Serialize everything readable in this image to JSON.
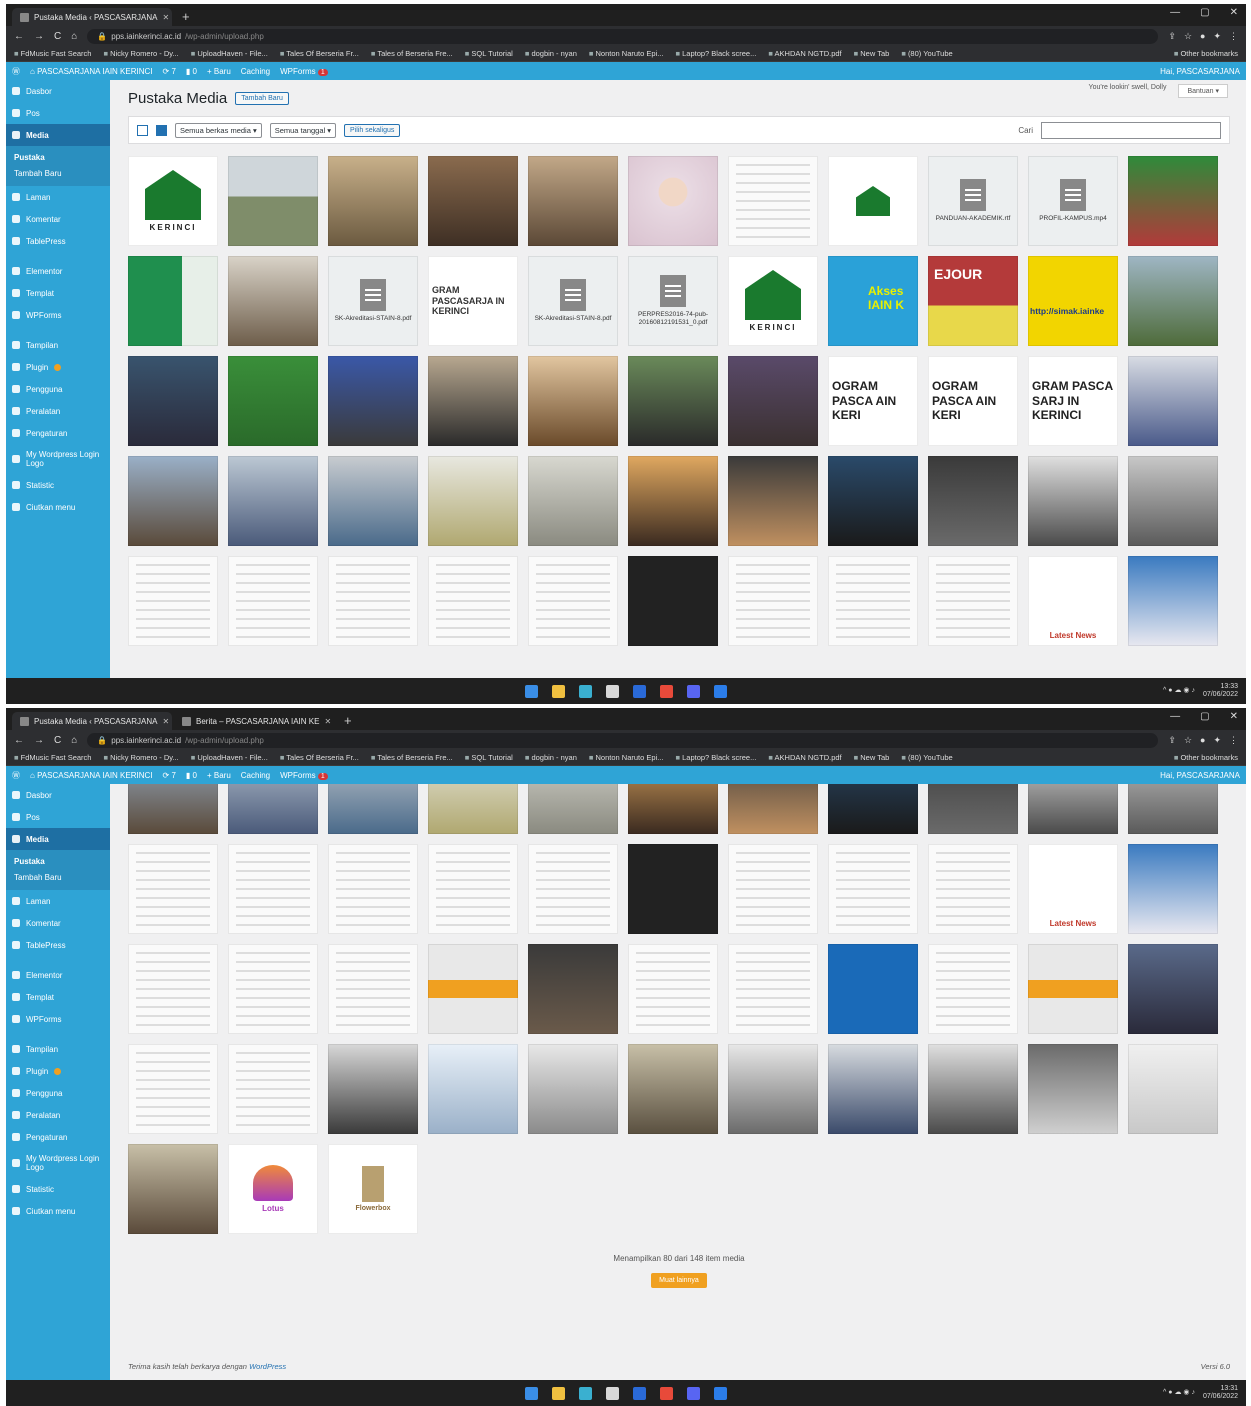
{
  "browser": {
    "tabs_top": [
      "Pustaka Media ‹ PASCASARJANA"
    ],
    "tabs_bottom": [
      "Pustaka Media ‹ PASCASARJANA",
      "Berita – PASCASARJANA IAIN KE"
    ],
    "url_host": "pps.iainkerinci.ac.id",
    "url_path": "/wp-admin/upload.php",
    "bookmarks": [
      "FdMusic Fast Search",
      "Nicky Romero - Dy...",
      "UploadHaven - File...",
      "Tales Of Berseria Fr...",
      "Tales of Berseria Fre...",
      "SQL Tutorial",
      "dogbin - nyan",
      "Nonton Naruto Epi...",
      "Laptop? Black scree...",
      "AKHDAN NGTD.pdf",
      "New Tab",
      "(80) YouTube"
    ],
    "other_bookmarks": "Other bookmarks"
  },
  "adminbar": {
    "site": "PASCASARJANA IAIN KERINCI",
    "updates": "7",
    "comments": "0",
    "new": "+ Baru",
    "caching": "Caching",
    "wpforms": "WPForms",
    "wpforms_badge": "1",
    "howdy": "Hai, PASCASARJANA"
  },
  "sidebar": {
    "items": [
      "Dasbor",
      "Pos",
      "Media",
      "Laman",
      "Komentar",
      "TablePress",
      "Elementor",
      "Templat",
      "WPForms",
      "Tampilan",
      "Plugin",
      "Pengguna",
      "Peralatan",
      "Pengaturan",
      "My Wordpress Login Logo",
      "Statistic",
      "Ciutkan menu"
    ],
    "sub": [
      "Pustaka",
      "Tambah Baru"
    ]
  },
  "header": {
    "title": "Pustaka Media",
    "add_new": "Tambah Baru",
    "notice": "You're lookin' swell, Dolly",
    "help": "Bantuan ▾"
  },
  "filters": {
    "media_type": "Semua berkas media ▾",
    "dates": "Semua tanggal ▾",
    "bulk_select": "Pilih sekaligus",
    "search_label": "Cari"
  },
  "tiles": {
    "logo_text": "KERINCI",
    "panduan": "PANDUAN-AKADEMIK.rtf",
    "profil": "PROFIL-KAMPUS.mp4",
    "sk1": "SK-Akreditasi-STAIN-8.pdf",
    "sk2": "SK-Akreditasi-STAIN-8.pdf",
    "perpres": "PERPRES2016-74-pub-20160812191531_0.pdf",
    "banner1": "GRAM PASCASARJA IN KERINCI",
    "akses": "Akses IAIN K",
    "ejour": "EJOUR",
    "simak": "http://simak.iainke",
    "pasca1": "OGRAM PASCA AIN KERI",
    "pasca2": "OGRAM PASCA AIN KERI",
    "pasca3": "GRAM PASCA SARJ IN KERINCI",
    "latest1": "Latest News",
    "latest2": "Latest News",
    "lotus": "Lotus",
    "flower": "Flowerbox"
  },
  "footer": {
    "count": "Menampilkan 80 dari 148 item media",
    "load_more": "Muat lainnya",
    "thanks": "Terima kasih telah berkarya dengan",
    "wp_link": "WordPress",
    "version": "Versi 6.0"
  },
  "taskbar": {
    "time_top": "13:33",
    "date_top": "07/06/2022",
    "time_bottom": "13:31",
    "date_bottom": "07/06/2022"
  }
}
